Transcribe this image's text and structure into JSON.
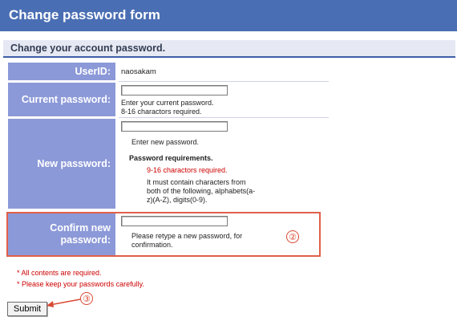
{
  "title": "Change password form",
  "subtitle": "Change your account password.",
  "fields": {
    "userid": {
      "label": "UserID:",
      "value": "naosakam"
    },
    "current": {
      "label": "Current password:",
      "hint_line1": "Enter your current password.",
      "hint_line2": "8-16 charactors required."
    },
    "newpw": {
      "label": "New password:",
      "hint": "Enter new password.",
      "req_title": "Password requirements.",
      "req_red": "9-16 charactors required.",
      "req_line1": "It must contain characters from",
      "req_line2": "both of the following, alphabets(a-",
      "req_line3": "z)(A-Z), digits(0-9)."
    },
    "confirm": {
      "label_line1": "Confirm new",
      "label_line2": "password:",
      "hint_line1": "Please retype a new password, for",
      "hint_line2": "confirmation."
    }
  },
  "notes": {
    "note1": "* All contents are required.",
    "note2": "* Please keep your passwords carefully."
  },
  "submit_label": "Submit",
  "annotations": {
    "a2": "②",
    "a3": "③"
  },
  "colors": {
    "title_bar": "#4a6eb3",
    "label_bg": "#8c99d8",
    "required_red": "#cc0000",
    "annotation": "#e0604a"
  }
}
